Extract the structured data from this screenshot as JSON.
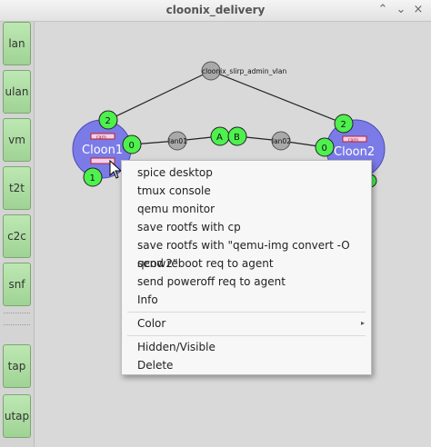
{
  "window": {
    "title": "cloonix_delivery",
    "min_glyph": "⌃",
    "max_glyph": "⌄",
    "close_glyph": "×"
  },
  "sidebar": {
    "items": [
      {
        "label": "lan"
      },
      {
        "label": "ulan"
      },
      {
        "label": "vm"
      },
      {
        "label": "t2t"
      },
      {
        "label": "c2c"
      },
      {
        "label": "snf"
      },
      {
        "label": "tap"
      },
      {
        "label": "utap"
      }
    ]
  },
  "topology": {
    "lan_admin": "cloonix_slirp_admin_vlan",
    "lan1": "lan01",
    "lan2": "lan02",
    "vm1": {
      "name": "Cloon1",
      "badge": "ram",
      "color": "#7b7be8"
    },
    "vm2": {
      "name": "Cloon2",
      "badge": "ram",
      "color": "#7b7be8"
    },
    "ports": [
      "2",
      "0",
      "1",
      "2",
      "0",
      "A",
      "B"
    ],
    "port_color": "#4ef04e",
    "lan_color": "#a9a9a9"
  },
  "menu": {
    "items": [
      "spice desktop",
      "tmux console",
      "qemu monitor",
      "save rootfs with cp",
      "save rootfs with \"qemu-img convert -O qcow2\"",
      "send reboot req to agent",
      "send poweroff req to agent",
      "Info"
    ],
    "color": "Color",
    "submenu_arrow": "▸",
    "hidden_visible": "Hidden/Visible",
    "delete": "Delete"
  }
}
